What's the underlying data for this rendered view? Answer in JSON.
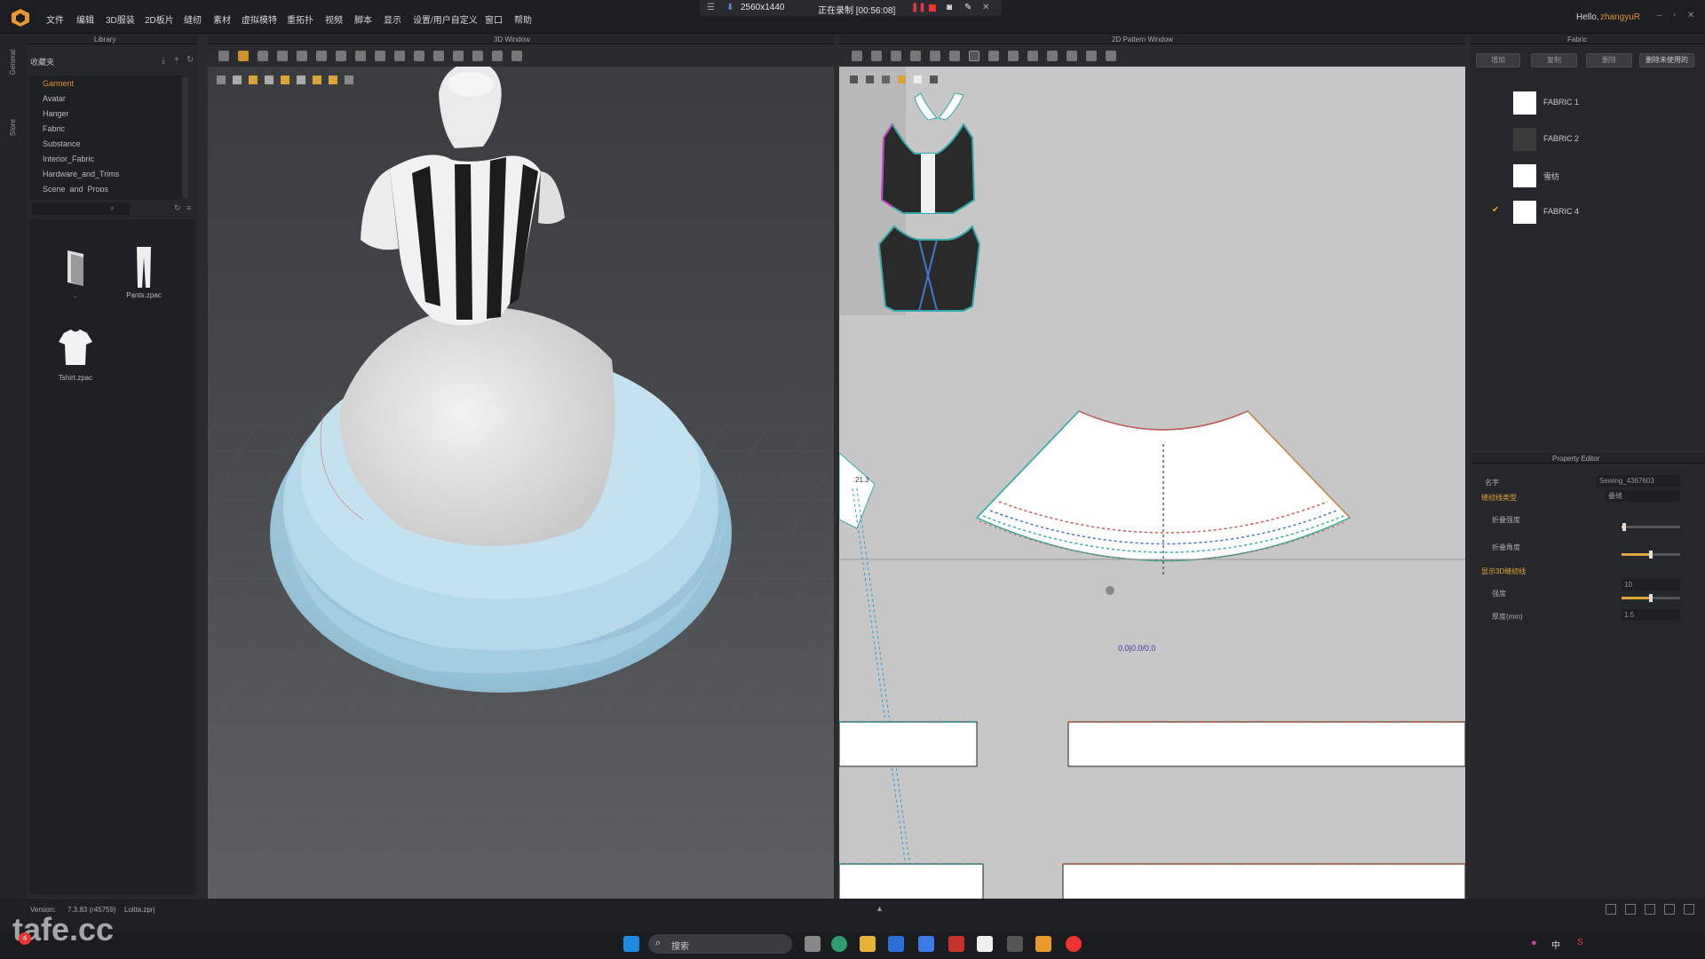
{
  "menubar": {
    "items": [
      "文件",
      "编辑",
      "3D服装",
      "2D板片",
      "缝纫",
      "素材",
      "虚拟模特",
      "重拓扑",
      "视频",
      "脚本",
      "显示",
      "设置/用户自定义",
      "窗口",
      "帮助"
    ],
    "greeting": "Hello,",
    "user": "zhangyuR"
  },
  "recording": {
    "resolution": "2560x1440",
    "status": "正在录制 [00:56:08]"
  },
  "panels": {
    "library": "Library",
    "view3d": "3D Window",
    "view2d": "2D Pattern Window",
    "fabric": "Fabric",
    "property": "Property Editor"
  },
  "side_tabs": [
    "General",
    "Store"
  ],
  "library": {
    "folder": "收藏夹",
    "tree": [
      "Garment",
      "Avatar",
      "Hanger",
      "Fabric",
      "Substance",
      "Interior_Fabric",
      "Hardware_and_Trims",
      "Scene_and_Props"
    ],
    "files": [
      {
        "label": "..",
        "icon": "folder-up-icon"
      },
      {
        "label": "Pants.zpac",
        "icon": "pants-icon"
      },
      {
        "label": "Tshirt.zpac",
        "icon": "tshirt-icon"
      }
    ]
  },
  "fabric": {
    "buttons": [
      "增加",
      "复制",
      "删除",
      "删除未使用的"
    ],
    "items": [
      {
        "name": "FABRIC 1",
        "swatch": "#ffffff",
        "checked": false
      },
      {
        "name": "FABRIC 2",
        "swatch": "#3a3a3a",
        "checked": false
      },
      {
        "name": "雪纺",
        "swatch": "#ffffff",
        "checked": false
      },
      {
        "name": "FABRIC 4",
        "swatch": "#ffffff",
        "checked": true
      }
    ]
  },
  "property": {
    "name_label": "名字",
    "name_value": "Sewing_4367603",
    "section1": "缝纫线类型",
    "type_value": "叠缝",
    "fold_strength": "折叠强度",
    "fold_angle": "折叠角度",
    "section2": "显示3D缝纫线",
    "strength": "强度",
    "strength_value": "10",
    "thickness": "厚度(mm)",
    "thickness_value": "1.5",
    "fold_strength_level": 0.05,
    "fold_angle_level": 0.5,
    "strength_level": 0.5
  },
  "pattern_readout": "0.0|0.0/0.0",
  "seam_label": "21.3",
  "status": {
    "version_label": "Version:",
    "version_value": "7.3.83 (r45759)",
    "file": "Lolita.zprj"
  },
  "taskbar": {
    "search": "搜索",
    "notif": "4",
    "lang": "中"
  },
  "watermark": "tafe.cc"
}
